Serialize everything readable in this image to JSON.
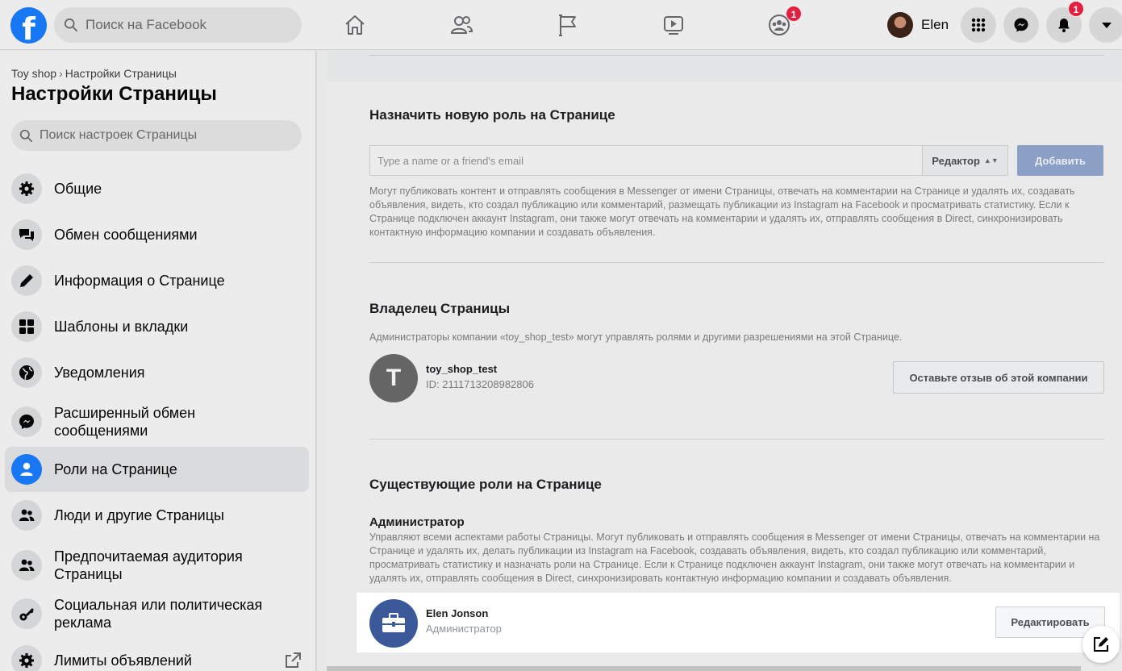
{
  "topbar": {
    "logo": "f",
    "search_placeholder": "Поиск на Facebook",
    "nav_badges": {
      "groups": "1"
    },
    "profile_name": "Elen",
    "notification_count": "1",
    "icons": [
      "home-icon",
      "friends-icon",
      "pages-flag-icon",
      "watch-icon",
      "groups-icon",
      "menu-grid-icon",
      "messenger-icon",
      "bell-icon",
      "caret-down-icon"
    ]
  },
  "sidebar": {
    "breadcrumb": {
      "page": "Toy shop",
      "separator": "›",
      "current": "Настройки Страницы"
    },
    "title": "Настройки Страницы",
    "search_placeholder": "Поиск настроек Страницы",
    "items": [
      {
        "label": "Общие",
        "icon": "gear-icon"
      },
      {
        "label": "Обмен сообщениями",
        "icon": "chat-bubbles-icon"
      },
      {
        "label": "Информация о Странице",
        "icon": "pencil-icon"
      },
      {
        "label": "Шаблоны и вкладки",
        "icon": "grid-tiles-icon"
      },
      {
        "label": "Уведомления",
        "icon": "globe-icon"
      },
      {
        "label": "Расширенный обмен сообщениями",
        "icon": "messenger-icon"
      },
      {
        "label": "Роли на Странице",
        "icon": "person-icon",
        "active": true
      },
      {
        "label": "Люди и другие Страницы",
        "icon": "people-icon"
      },
      {
        "label": "Предпочитаемая аудитория Страницы",
        "icon": "people-icon"
      },
      {
        "label": "Социальная или политическая реклама",
        "icon": "key-icon"
      },
      {
        "label": "Лимиты объявлений",
        "icon": "gear-icon",
        "external": true
      }
    ]
  },
  "assign_role": {
    "title": "Назначить новую роль на Странице",
    "input_placeholder": "Type a name or a friend's email",
    "role_select": "Редактор",
    "add_button": "Добавить",
    "description": "Могут публиковать контент и отправлять сообщения в Messenger от имени Страницы, отвечать на комментарии на Странице и удалять их, создавать объявления, видеть, кто создал публикацию или комментарий, размещать публикации из Instagram на Facebook и просматривать статистику. Если к Странице подключен аккаунт Instagram, они также могут отвечать на комментарии и удалять их, отправлять сообщения в Direct, синхронизировать контактную информацию компании и создавать объявления."
  },
  "owner": {
    "title": "Владелец Страницы",
    "description": "Администраторы компании «toy_shop_test» могут управлять ролями и другими разрешениями на этой Странице.",
    "avatar_letter": "T",
    "name": "toy_shop_test",
    "id": "ID: 2111713208982806",
    "review_button": "Оставьте отзыв об этой компании"
  },
  "existing_roles": {
    "title": "Существующие роли на Странице",
    "admin_heading": "Администратор",
    "admin_description": "Управляют всеми аспектами работы Страницы. Могут публиковать и отправлять сообщения в Messenger от имени Страницы, отвечать на комментарии на Странице и удалять их, делать публикации из Instagram на Facebook, создавать объявления, видеть, кто создал публикацию или комментарий, просматривать статистику и назначать роли на Странице. Если к Странице подключен аккаунт Instagram, они также могут отвечать на комментарии и удалять их, отправлять сообщения в Direct, синхронизировать контактную информацию компании и создавать объявления.",
    "members": [
      {
        "name": "Elen Jonson",
        "role": "Администратор",
        "edit_button": "Редактировать"
      }
    ]
  },
  "colors": {
    "accent": "#1877f2",
    "notification": "#e41e3f",
    "admin_avatar": "#3b5998",
    "add_button_disabled": "#8c9fc5"
  }
}
